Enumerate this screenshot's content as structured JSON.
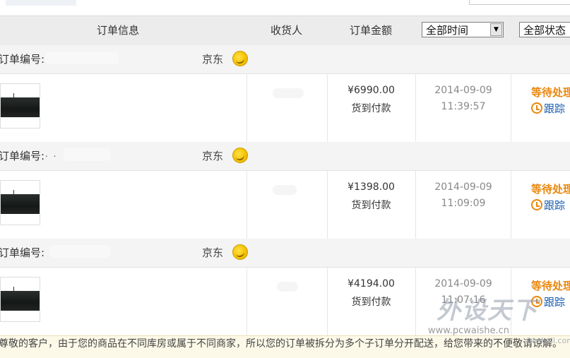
{
  "header": {
    "order_info": "订单信息",
    "receiver": "收货人",
    "amount": "订单金额",
    "time_filter": "全部时间",
    "status_filter": "全部状态"
  },
  "orders": [
    {
      "number_label": "订单编号:",
      "shop": "京东",
      "price": "¥6990.00",
      "payment": "货到付款",
      "date": "2014-09-09",
      "time": "11:39:57",
      "status": "等待处理",
      "track": "跟踪"
    },
    {
      "number_label": "订单编号:",
      "number_dots": ". .",
      "shop": "京东",
      "price": "¥1398.00",
      "payment": "货到付款",
      "date": "2014-09-09",
      "time": "11:09:09",
      "status": "等待处理",
      "track": "跟踪"
    },
    {
      "number_label": "订单编号:",
      "shop": "京东",
      "price": "¥4194.00",
      "payment": "货到付款",
      "date": "2014-09-09",
      "time": "11:07:16",
      "status": "等待处理",
      "track": "跟踪"
    }
  ],
  "notice": "尊敬的客户，由于您的商品在不同库房或属于不同商家，所以您的订单被拆分为多个子订单分开配送，给您带来的不便敬请谅解。",
  "watermark": {
    "title": "外设天下",
    "url": "www.pcwaishe.cn",
    "corner": "itbshell.com"
  }
}
